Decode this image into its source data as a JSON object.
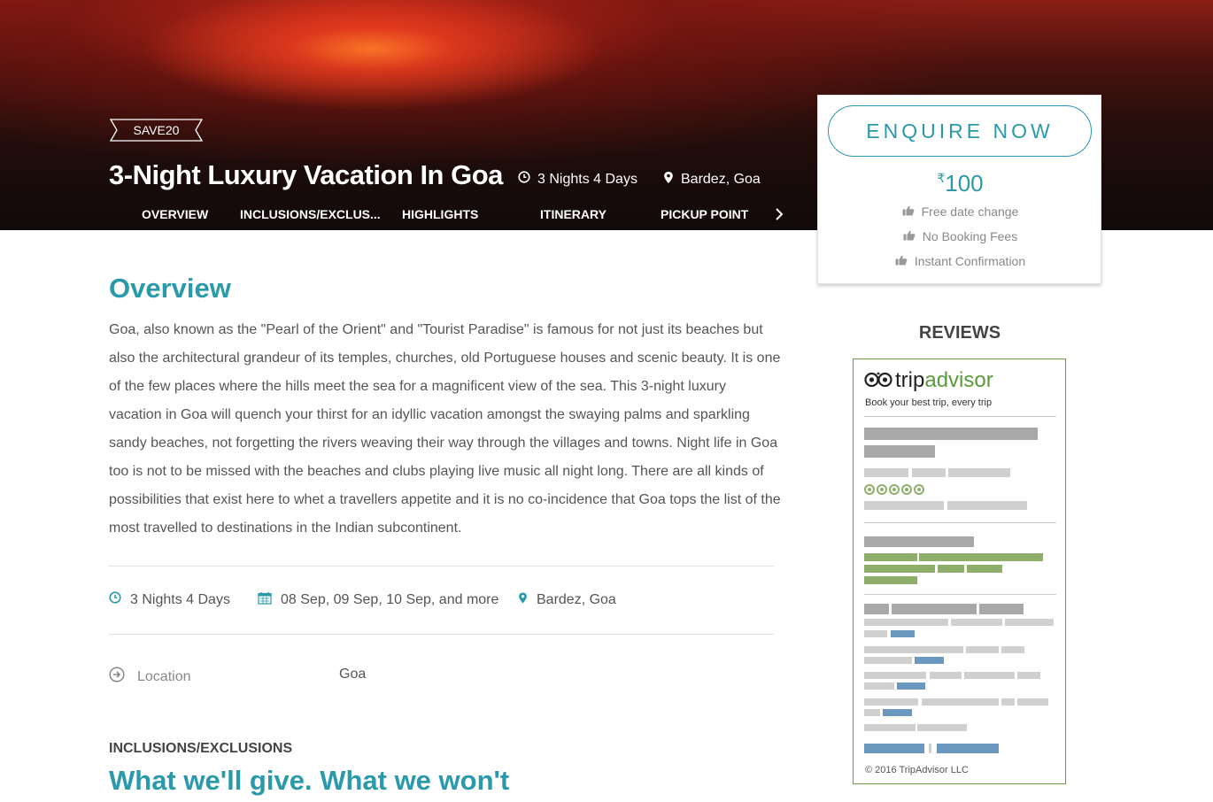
{
  "hero": {
    "badge": "SAVE20",
    "title": "3-Night Luxury Vacation In Goa",
    "duration": "3 Nights 4 Days",
    "location": "Bardez, Goa",
    "tabs": [
      "OVERVIEW",
      "INCLUSIONS/EXCLUS...",
      "HIGHLIGHTS",
      "ITINERARY",
      "PICKUP POINT"
    ]
  },
  "enquire": {
    "button_label": "ENQUIRE NOW",
    "currency": "₹",
    "price": "100",
    "perks": [
      "Free date change",
      "No Booking Fees",
      "Instant Confirmation"
    ]
  },
  "overview": {
    "title": "Overview",
    "text": "Goa, also known as the \"Pearl of the Orient\" and \"Tourist Paradise\" is famous for not just its beaches but also the architectural grandeur of its temples, churches, old Portuguese houses and scenic beauty. It is one of the few places where the hills meet the sea for a magnificent view of the sea. This 3-night luxury vacation in Goa will quench your thirst for an idyllic vacation amongst the swaying palms and sparkling sandy beaches, not forgetting the rivers weaving their way through the villages and towns. Night life in Goa too is not to be missed with the beaches and clubs playing live music all night long. There are all kinds of possibilities that exist here to whet a travellers appetite and it is no co-incidence that Goa tops the list of the most travelled to destinations in the Indian subcontinent.",
    "duration": "3 Nights 4 Days",
    "dates": "08 Sep, 09 Sep, 10 Sep, and more",
    "location": "Bardez, Goa",
    "location_label": "Location",
    "location_value": "Goa"
  },
  "inclusions": {
    "label": "INCLUSIONS/EXCLUSIONS",
    "title": "What we'll give. What we won't"
  },
  "reviews": {
    "title": "REVIEWS",
    "brand_trip": "trip",
    "brand_advisor": "advisor",
    "tagline": "Book your best trip, every trip",
    "copyright": "© 2016 TripAdvisor LLC"
  },
  "colors": {
    "accent": "#2a9aab",
    "tripadvisor_green": "#5a9a3a"
  }
}
